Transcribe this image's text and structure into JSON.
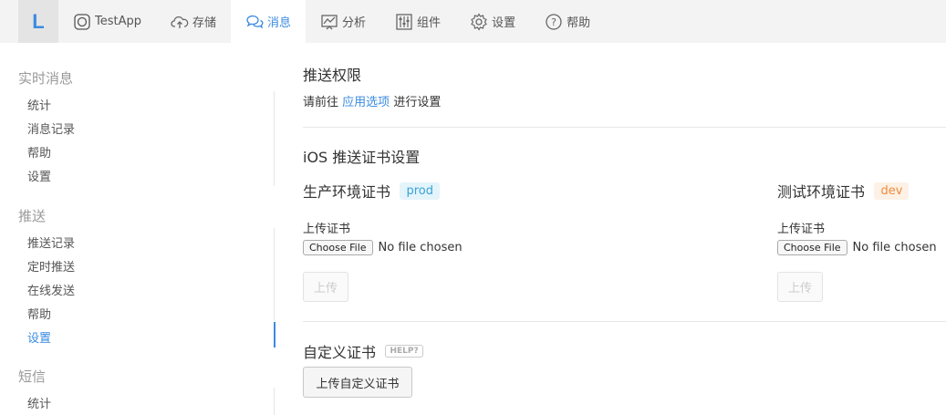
{
  "nav": {
    "logo": "L",
    "items": [
      {
        "label": "TestApp",
        "icon": "app-icon"
      },
      {
        "label": "存储",
        "icon": "cloud-upload-icon"
      },
      {
        "label": "消息",
        "icon": "chat-bubbles-icon",
        "active": true
      },
      {
        "label": "分析",
        "icon": "chart-icon"
      },
      {
        "label": "组件",
        "icon": "sliders-icon"
      },
      {
        "label": "设置",
        "icon": "gear-icon"
      },
      {
        "label": "帮助",
        "icon": "help-circle-icon"
      }
    ]
  },
  "sidebar": {
    "groups": [
      {
        "title": "实时消息",
        "items": [
          "统计",
          "消息记录",
          "帮助",
          "设置"
        ]
      },
      {
        "title": "推送",
        "items": [
          "推送记录",
          "定时推送",
          "在线发送",
          "帮助",
          "设置"
        ],
        "active_index": 4
      },
      {
        "title": "短信",
        "items": [
          "统计"
        ]
      }
    ]
  },
  "main": {
    "push_permission": {
      "title": "推送权限",
      "text_before": "请前往",
      "link": "应用选项",
      "text_after": "进行设置"
    },
    "ios_cert": {
      "title": "iOS 推送证书设置",
      "prod": {
        "title": "生产环境证书",
        "badge": "prod",
        "upload_label": "上传证书",
        "file_button": "Choose File",
        "file_status": "No file chosen",
        "upload_button": "上传"
      },
      "dev": {
        "title": "测试环境证书",
        "badge": "dev",
        "upload_label": "上传证书",
        "file_button": "Choose File",
        "file_status": "No file chosen",
        "upload_button": "上传"
      }
    },
    "custom_cert": {
      "title": "自定义证书",
      "help_badge": "HELP?",
      "button": "上传自定义证书"
    }
  },
  "colors": {
    "accent": "#3b8be0",
    "prod_badge": "#3aa3d8",
    "dev_badge": "#f08a3c"
  }
}
